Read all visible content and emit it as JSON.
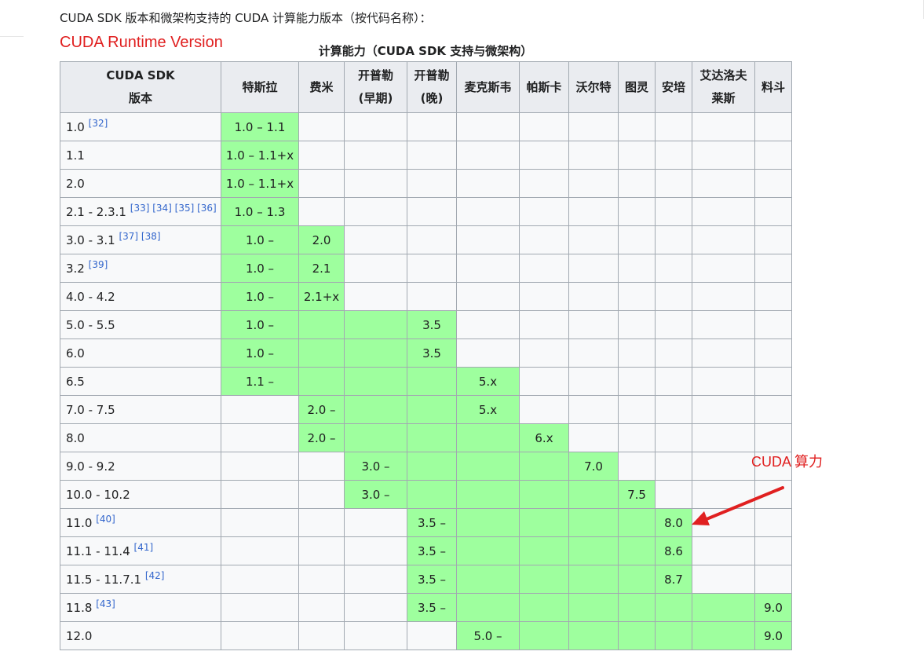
{
  "intro": "CUDA SDK 版本和微架构支持的 CUDA 计算能力版本（按代码名称）：",
  "annotations": {
    "runtime": "CUDA Runtime Version",
    "capability": "CUDA 算力",
    "color": "#e02020"
  },
  "table": {
    "caption": "计算能力（CUDA SDK 支持与微架构）",
    "headers": [
      {
        "l1": "CUDA SDK",
        "l2": "版本"
      },
      {
        "l1": "特斯拉",
        "l2": ""
      },
      {
        "l1": "费米",
        "l2": ""
      },
      {
        "l1": "开普勒",
        "l2": "(早期)"
      },
      {
        "l1": "开普勒",
        "l2": "(晚)"
      },
      {
        "l1": "麦克斯韦",
        "l2": ""
      },
      {
        "l1": "帕斯卡",
        "l2": ""
      },
      {
        "l1": "沃尔特",
        "l2": ""
      },
      {
        "l1": "图灵",
        "l2": ""
      },
      {
        "l1": "安培",
        "l2": ""
      },
      {
        "l1": "艾达洛夫",
        "l2": "莱斯"
      },
      {
        "l1": "料斗",
        "l2": ""
      }
    ],
    "highlight_color": "#9eff9e",
    "rows": [
      {
        "version": "1.0",
        "refs": "[32]",
        "cells": [
          "1.0 – 1.1",
          null,
          null,
          null,
          null,
          null,
          null,
          null,
          null,
          null,
          null
        ]
      },
      {
        "version": "1.1",
        "refs": "",
        "cells": [
          "1.0 – 1.1+x",
          null,
          null,
          null,
          null,
          null,
          null,
          null,
          null,
          null,
          null
        ]
      },
      {
        "version": "2.0",
        "refs": "",
        "cells": [
          "1.0 – 1.1+x",
          null,
          null,
          null,
          null,
          null,
          null,
          null,
          null,
          null,
          null
        ]
      },
      {
        "version": "2.1 - 2.3.1",
        "refs": "[33] [34] [35] [36]",
        "cells": [
          "1.0 – 1.3",
          null,
          null,
          null,
          null,
          null,
          null,
          null,
          null,
          null,
          null
        ]
      },
      {
        "version": "3.0 - 3.1",
        "refs": "[37] [38]",
        "cells": [
          "1.0 –",
          "2.0",
          null,
          null,
          null,
          null,
          null,
          null,
          null,
          null,
          null
        ]
      },
      {
        "version": "3.2",
        "refs": "[39]",
        "cells": [
          "1.0 –",
          "2.1",
          null,
          null,
          null,
          null,
          null,
          null,
          null,
          null,
          null
        ]
      },
      {
        "version": "4.0 - 4.2",
        "refs": "",
        "cells": [
          "1.0 –",
          "2.1+x",
          null,
          null,
          null,
          null,
          null,
          null,
          null,
          null,
          null
        ]
      },
      {
        "version": "5.0 - 5.5",
        "refs": "",
        "cells": [
          "1.0 –",
          "",
          "",
          "3.5",
          null,
          null,
          null,
          null,
          null,
          null,
          null
        ]
      },
      {
        "version": "6.0",
        "refs": "",
        "cells": [
          "1.0 –",
          "",
          "",
          "3.5",
          null,
          null,
          null,
          null,
          null,
          null,
          null
        ]
      },
      {
        "version": "6.5",
        "refs": "",
        "cells": [
          "1.1 –",
          "",
          "",
          "",
          "5.x",
          null,
          null,
          null,
          null,
          null,
          null
        ]
      },
      {
        "version": "7.0 - 7.5",
        "refs": "",
        "cells": [
          null,
          "2.0 –",
          "",
          "",
          "5.x",
          null,
          null,
          null,
          null,
          null,
          null
        ]
      },
      {
        "version": "8.0",
        "refs": "",
        "cells": [
          null,
          "2.0 –",
          "",
          "",
          "",
          "6.x",
          null,
          null,
          null,
          null,
          null
        ]
      },
      {
        "version": "9.0 - 9.2",
        "refs": "",
        "cells": [
          null,
          null,
          "3.0 –",
          "",
          "",
          "",
          "7.0",
          null,
          null,
          null,
          null
        ]
      },
      {
        "version": "10.0 - 10.2",
        "refs": "",
        "cells": [
          null,
          null,
          "3.0 –",
          "",
          "",
          "",
          "",
          "7.5",
          null,
          null,
          null
        ]
      },
      {
        "version": "11.0",
        "refs": "[40]",
        "cells": [
          null,
          null,
          null,
          "3.5 –",
          "",
          "",
          "",
          "",
          "8.0",
          null,
          null
        ]
      },
      {
        "version": "11.1 - 11.4",
        "refs": "[41]",
        "cells": [
          null,
          null,
          null,
          "3.5 –",
          "",
          "",
          "",
          "",
          "8.6",
          null,
          null
        ]
      },
      {
        "version": "11.5 - 11.7.1",
        "refs": "[42]",
        "cells": [
          null,
          null,
          null,
          "3.5 –",
          "",
          "",
          "",
          "",
          "8.7",
          null,
          null
        ]
      },
      {
        "version": "11.8",
        "refs": "[43]",
        "cells": [
          null,
          null,
          null,
          "3.5 –",
          "",
          "",
          "",
          "",
          "",
          "",
          "9.0"
        ]
      },
      {
        "version": "12.0",
        "refs": "",
        "cells": [
          null,
          null,
          null,
          null,
          "5.0 –",
          "",
          "",
          "",
          "",
          "",
          "9.0"
        ]
      }
    ]
  }
}
